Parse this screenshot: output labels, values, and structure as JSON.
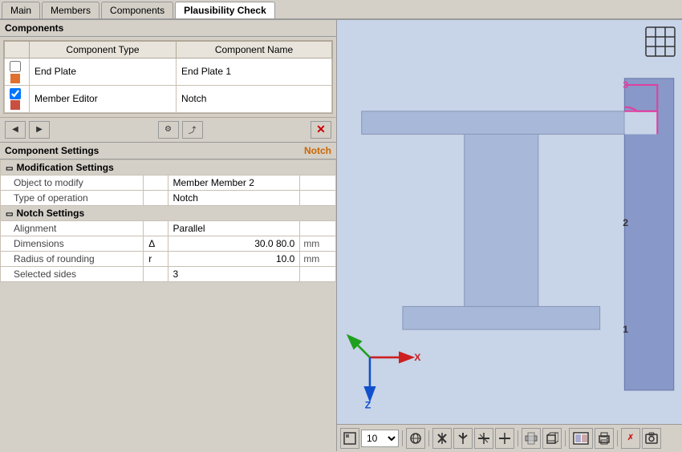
{
  "tabs": [
    {
      "label": "Main",
      "active": false
    },
    {
      "label": "Members",
      "active": false
    },
    {
      "label": "Components",
      "active": false
    },
    {
      "label": "Plausibility Check",
      "active": true
    }
  ],
  "left": {
    "components_header": "Components",
    "table_headers": [
      "Component Type",
      "Component Name"
    ],
    "components": [
      {
        "checked": false,
        "color": "#e07030",
        "type": "End Plate",
        "name": "End Plate 1"
      },
      {
        "checked": true,
        "color": "#c85040",
        "type": "Member Editor",
        "name": "Notch"
      }
    ],
    "toolbar_buttons": [
      {
        "icon": "⬆",
        "name": "move-up-button"
      },
      {
        "icon": "⬇",
        "name": "move-down-button"
      },
      {
        "icon": "✦",
        "name": "add-button"
      },
      {
        "icon": "⤴",
        "name": "export-button"
      },
      {
        "icon": "✕",
        "name": "delete-button"
      }
    ],
    "settings_header": "Component Settings",
    "settings_label": "Notch",
    "sections": [
      {
        "name": "Modification Settings",
        "rows": [
          {
            "label": "Object to modify",
            "symbol": "",
            "value": "Member",
            "value2": "Member 2",
            "unit": ""
          },
          {
            "label": "Type of operation",
            "symbol": "",
            "value": "Notch",
            "value2": "",
            "unit": ""
          }
        ]
      },
      {
        "name": "Notch Settings",
        "rows": [
          {
            "label": "Alignment",
            "symbol": "",
            "value": "Parallel",
            "value2": "",
            "unit": ""
          },
          {
            "label": "Dimensions",
            "symbol": "Δ",
            "value": "30.0",
            "value2": "80.0",
            "unit": "mm"
          },
          {
            "label": "Radius of rounding",
            "symbol": "r",
            "value": "10.0",
            "value2": "",
            "unit": "mm"
          },
          {
            "label": "Selected sides",
            "symbol": "",
            "value": "3",
            "value2": "",
            "unit": ""
          }
        ]
      }
    ]
  },
  "viewport": {
    "labels": [
      "1",
      "2",
      "3"
    ],
    "axis_x": "X",
    "axis_z": "Z"
  },
  "bottom_toolbar": {
    "zoom_value": "10",
    "buttons": [
      "fit-view",
      "zoom-value",
      "perspective",
      "iso-x",
      "iso-y",
      "iso-z",
      "iso-nz",
      "shading",
      "box",
      "render",
      "print",
      "undo-render",
      "screenshot"
    ]
  }
}
